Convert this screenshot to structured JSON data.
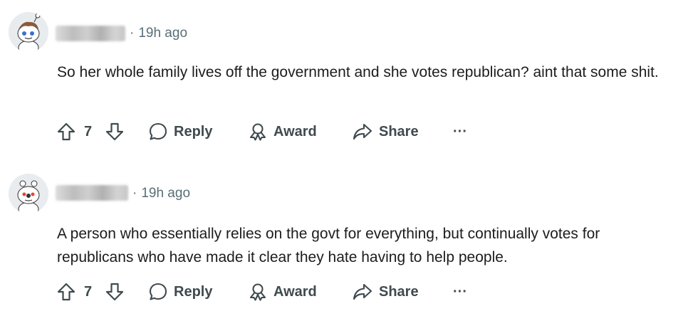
{
  "comments": [
    {
      "time": "19h ago",
      "text": "So her whole family lives off the government and she votes republican? aint that some shit.",
      "score": "7",
      "actions": {
        "reply": "Reply",
        "award": "Award",
        "share": "Share",
        "more": "···"
      }
    },
    {
      "time": "19h ago",
      "text": "A person who essentially relies on the govt for everything, but continually votes for republicans who have made it clear they hate having to help people.",
      "score": "7",
      "actions": {
        "reply": "Reply",
        "award": "Award",
        "share": "Share",
        "more": "···"
      }
    }
  ],
  "meta_separator": "·",
  "colors": {
    "text": "#1c1c1c",
    "meta": "#576f76",
    "icon": "#3f4a4f",
    "avatar_bg": "#e9ecef"
  }
}
